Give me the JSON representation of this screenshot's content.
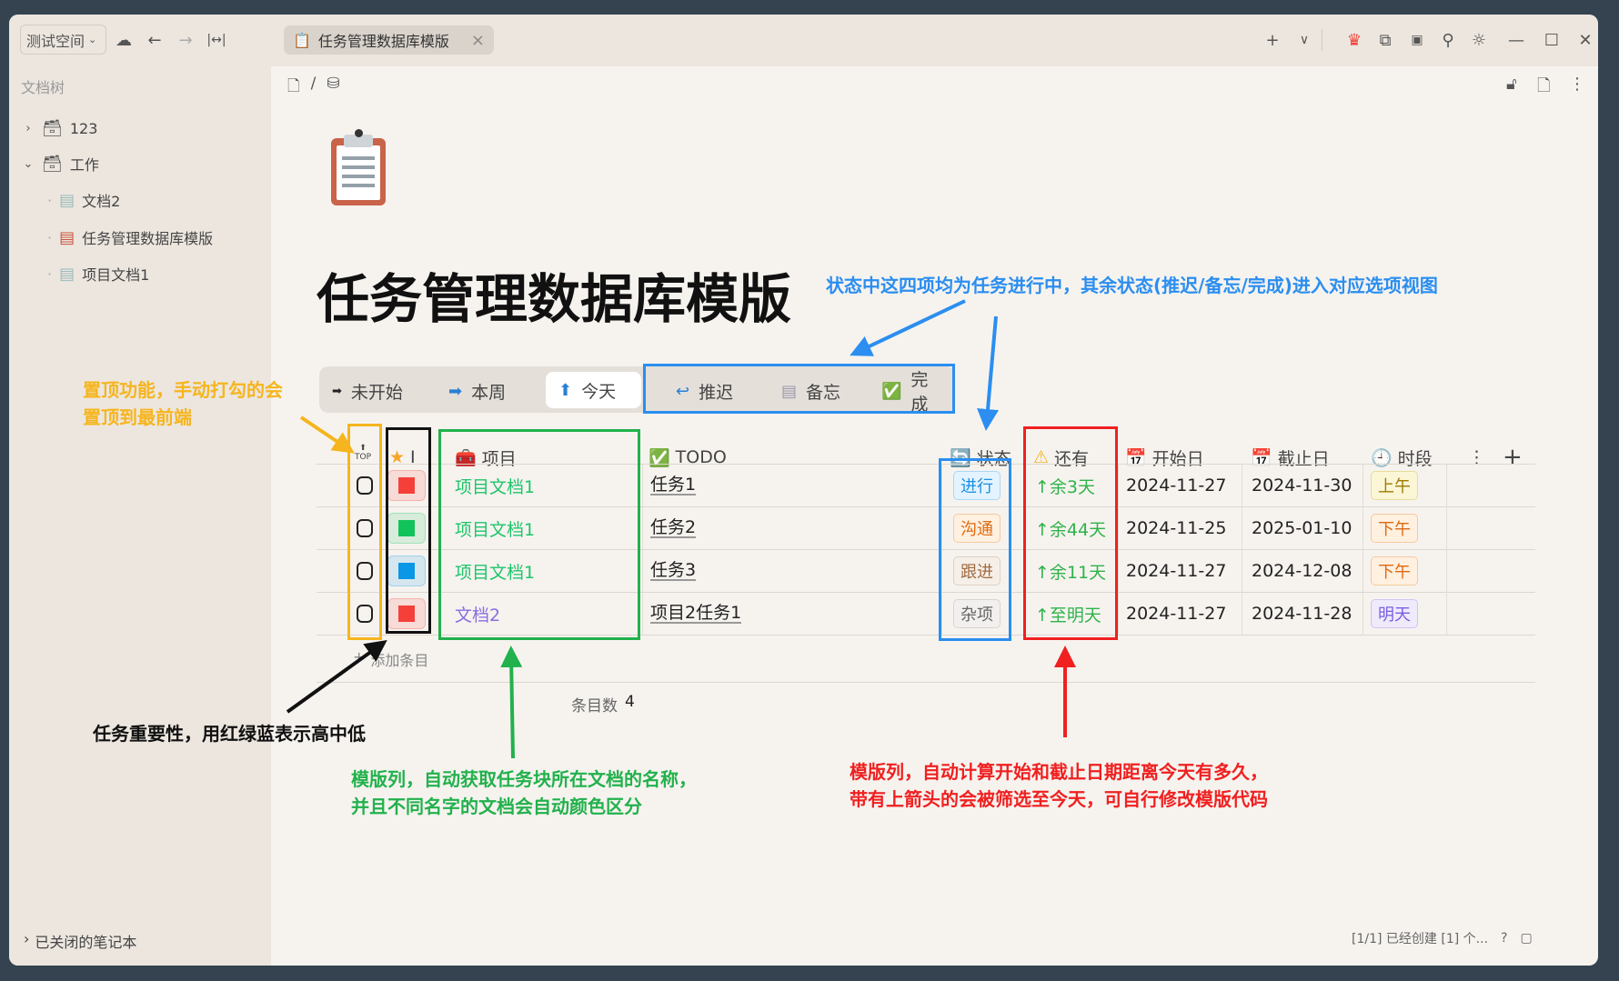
{
  "titlebar": {
    "workspace": "测试空间",
    "tab_title": "任务管理数据库模版",
    "icons": [
      "cloud-off-icon",
      "back-icon",
      "forward-icon",
      "collapse-icon",
      "plus-icon",
      "chevron-down-icon",
      "crown-icon",
      "plugin-icon",
      "terminal-icon",
      "search-icon",
      "theme-icon",
      "minimize-icon",
      "maximize-icon",
      "close-icon"
    ]
  },
  "sidebar": {
    "header": "文档树",
    "items": [
      {
        "label": "123",
        "level": 0,
        "expanded": false
      },
      {
        "label": "工作",
        "level": 0,
        "expanded": true
      },
      {
        "label": "文档2",
        "level": 1
      },
      {
        "label": "任务管理数据库模版",
        "level": 1
      },
      {
        "label": "项目文档1",
        "level": 1
      }
    ],
    "footer": "已关闭的笔记本"
  },
  "page": {
    "title": "任务管理数据库模版",
    "breadcrumb_sep": "/"
  },
  "views": [
    {
      "label": "未开始",
      "icon": "soon-icon"
    },
    {
      "label": "本周",
      "icon": "right-arrow-icon"
    },
    {
      "label": "今天",
      "icon": "up-arrow-icon",
      "active": true
    },
    {
      "label": "推迟",
      "icon": "return-icon"
    },
    {
      "label": "备忘",
      "icon": "notepad-icon"
    },
    {
      "label": "完成",
      "icon": "check-icon"
    }
  ],
  "table": {
    "columns": {
      "top": "TOP",
      "importance": "I",
      "project": "项目",
      "todo": "TODO",
      "status": "状态",
      "remaining": "还有",
      "start": "开始日",
      "end": "截止日",
      "period": "时段"
    },
    "rows": [
      {
        "importance_color": "#f5403a",
        "project": "项目文档1",
        "project_color": "#1fc46b",
        "todo": "任务1",
        "status": "进行",
        "remaining": "↑余3天",
        "start": "2024-11-27",
        "end": "2024-11-30",
        "period": "上午"
      },
      {
        "importance_color": "#12c25a",
        "project": "项目文档1",
        "project_color": "#1fc46b",
        "todo": "任务2",
        "status": "沟通",
        "remaining": "↑余44天",
        "start": "2024-11-25",
        "end": "2025-01-10",
        "period": "下午"
      },
      {
        "importance_color": "#0a97e6",
        "project": "项目文档1",
        "project_color": "#1fc46b",
        "todo": "任务3",
        "status": "跟进",
        "remaining": "↑余11天",
        "start": "2024-11-27",
        "end": "2024-12-08",
        "period": "下午"
      },
      {
        "importance_color": "#f5403a",
        "project": "文档2",
        "project_color": "#8a6de0",
        "todo": "项目2任务1",
        "status": "杂项",
        "remaining": "↑至明天",
        "start": "2024-11-27",
        "end": "2024-11-28",
        "period": "明天"
      }
    ],
    "add_row": "添加条目",
    "count_label": "条目数",
    "count": "4"
  },
  "annotations": {
    "top": [
      "置顶功能，手动打勾的会",
      "置顶到最前端"
    ],
    "importance": "任务重要性，用红绿蓝表示高中低",
    "project": [
      "模版列，自动获取任务块所在文档的名称，",
      "并且不同名字的文档会自动颜色区分"
    ],
    "remaining": [
      "模版列，自动计算开始和截止日期距离今天有多久，",
      "带有上箭头的会被筛选至今天，可自行修改模版代码"
    ],
    "status": "状态中这四项均为任务进行中，其余状态(推迟/备忘/完成)进入对应选项视图"
  },
  "statusbar": {
    "text": "[1/1] 已经创建 [1] 个..."
  },
  "colors": {
    "orange": "#f6b51e",
    "blue": "#2b8ef0",
    "green": "#22b14c",
    "red": "#f02020",
    "black": "#111111"
  }
}
